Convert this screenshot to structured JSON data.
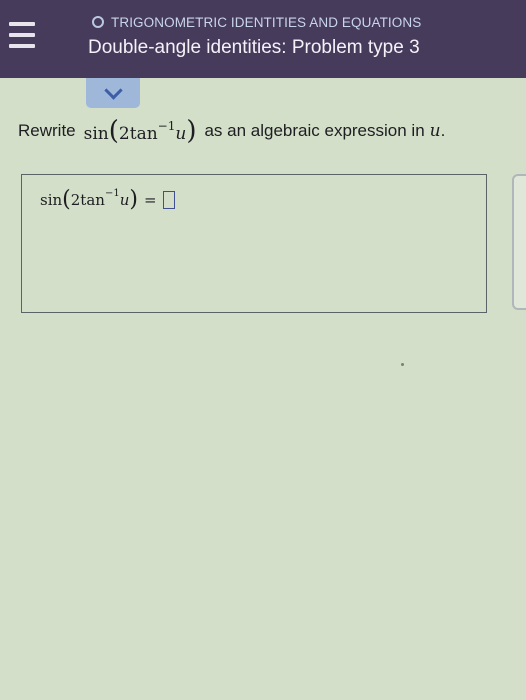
{
  "header": {
    "topic": "TRIGONOMETRIC IDENTITIES AND EQUATIONS",
    "title": "Double-angle identities: Problem type 3"
  },
  "question": {
    "prefix": "Rewrite",
    "func": "sin",
    "coef": "2",
    "inner_func": "tan",
    "exponent": "−1",
    "variable": "u",
    "suffix": "as an algebraic expression in",
    "suffix_var": "u",
    "suffix_end": "."
  },
  "answer": {
    "func": "sin",
    "coef": "2",
    "inner_func": "tan",
    "exponent": "−1",
    "variable": "u",
    "equals": "=",
    "value": ""
  },
  "icons": {
    "menu": "hamburger-icon",
    "collapse": "chevron-down-icon",
    "topic": "circle-icon"
  },
  "colors": {
    "header_bg": "#473b5c",
    "page_bg": "#d3dfc8",
    "tab_bg": "#9fb8d9"
  }
}
